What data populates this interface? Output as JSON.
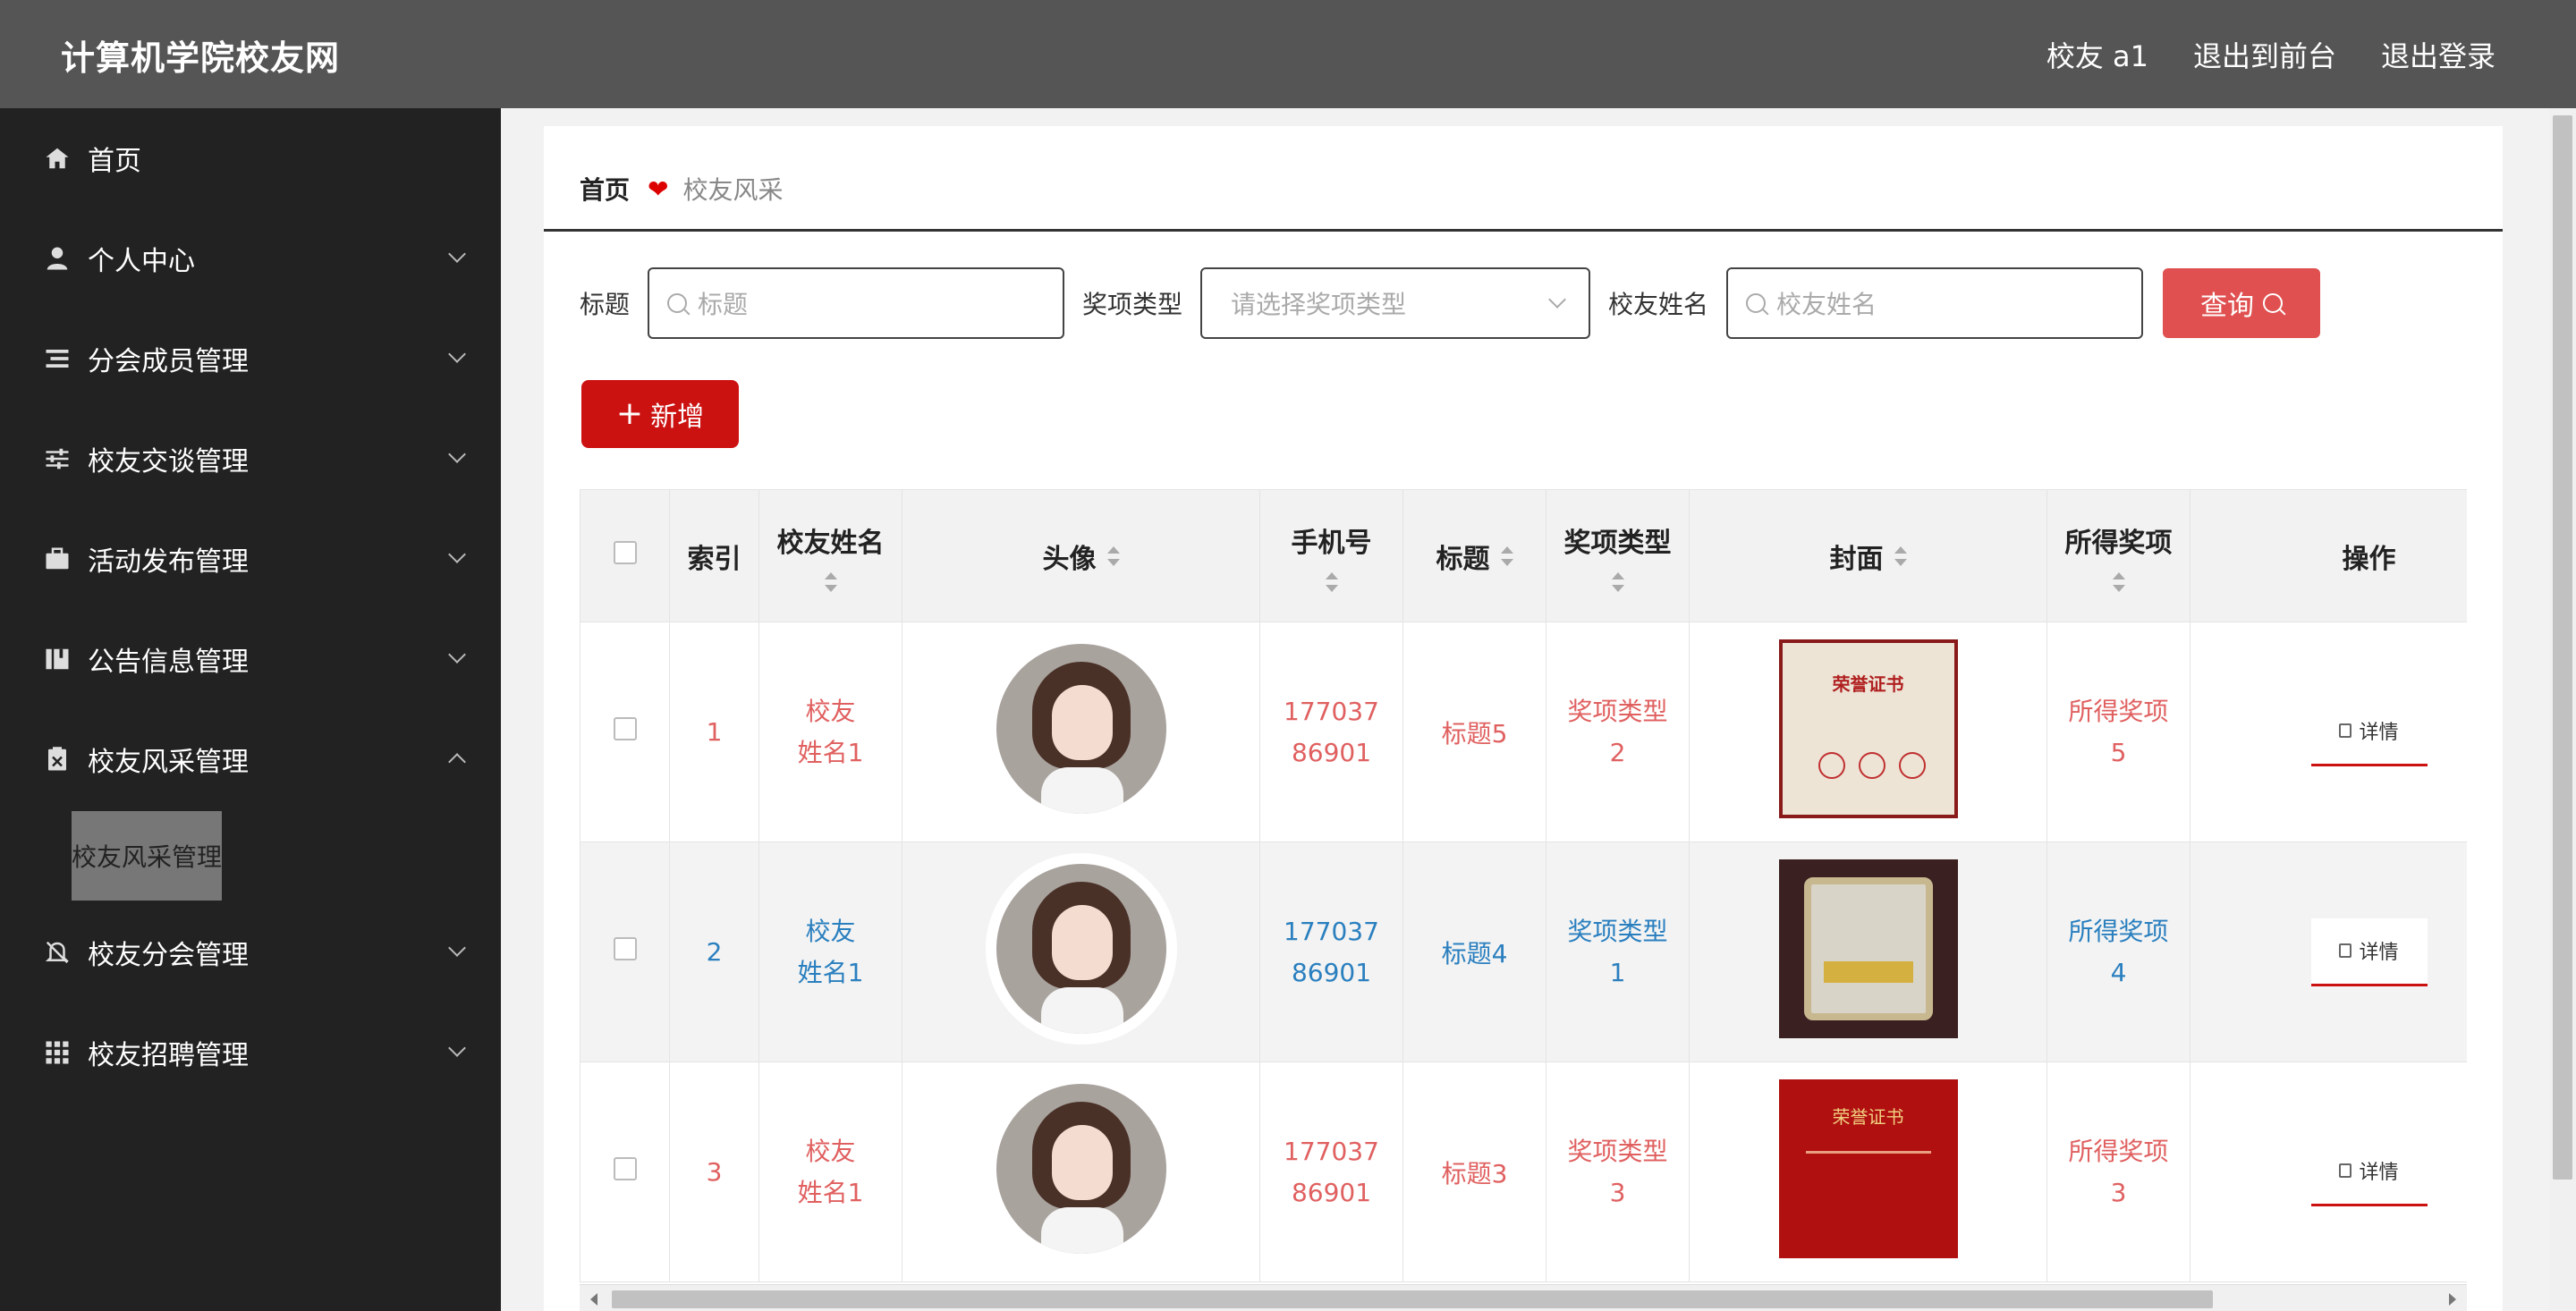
{
  "header": {
    "title": "计算机学院校友网",
    "user_label": "校友 a1",
    "back_label": "退出到前台",
    "logout_label": "退出登录"
  },
  "sidebar": {
    "items": [
      {
        "label": "首页",
        "icon": "home-icon"
      },
      {
        "label": "个人中心",
        "icon": "user-icon"
      },
      {
        "label": "分会成员管理",
        "icon": "list-icon"
      },
      {
        "label": "校友交谈管理",
        "icon": "sliders-icon"
      },
      {
        "label": "活动发布管理",
        "icon": "briefcase-icon"
      },
      {
        "label": "公告信息管理",
        "icon": "book-icon"
      },
      {
        "label": "校友风采管理",
        "icon": "clipboard-icon",
        "expanded": true,
        "sub": "校友风采管理"
      },
      {
        "label": "校友分会管理",
        "icon": "bell-off-icon"
      },
      {
        "label": "校友招聘管理",
        "icon": "grid-icon"
      }
    ]
  },
  "breadcrumb": {
    "home": "首页",
    "current": "校友风采"
  },
  "search": {
    "title_label": "标题",
    "title_placeholder": "标题",
    "type_label": "奖项类型",
    "type_placeholder": "请选择奖项类型",
    "name_label": "校友姓名",
    "name_placeholder": "校友姓名",
    "query_label": "查询"
  },
  "add_label": "新增",
  "table": {
    "headers": {
      "index": "索引",
      "name": "校友姓名",
      "avatar": "头像",
      "phone": "手机号",
      "title": "标题",
      "type": "奖项类型",
      "cover": "封面",
      "award": "所得奖项",
      "ops": "操作"
    },
    "rows": [
      {
        "index": "1",
        "name": "校友姓名1",
        "phone": "17703786901",
        "title": "标题5",
        "type": "奖项类型2",
        "award": "所得奖项5",
        "detail": "详情",
        "cover_title": "荣誉证书"
      },
      {
        "index": "2",
        "name": "校友姓名1",
        "phone": "17703786901",
        "title": "标题4",
        "type": "奖项类型1",
        "award": "所得奖项4",
        "detail": "详情",
        "cover_title": ""
      },
      {
        "index": "3",
        "name": "校友姓名1",
        "phone": "17703786901",
        "title": "标题3",
        "type": "奖项类型3",
        "award": "所得奖项3",
        "detail": "详情",
        "cover_title": "荣誉证书"
      }
    ]
  },
  "colors": {
    "header_bg": "#555555",
    "sidebar_bg": "#222222",
    "accent_red": "#cc1111",
    "query_red": "#e05050",
    "text_red": "#e06060",
    "text_blue": "#2a7fbf"
  }
}
